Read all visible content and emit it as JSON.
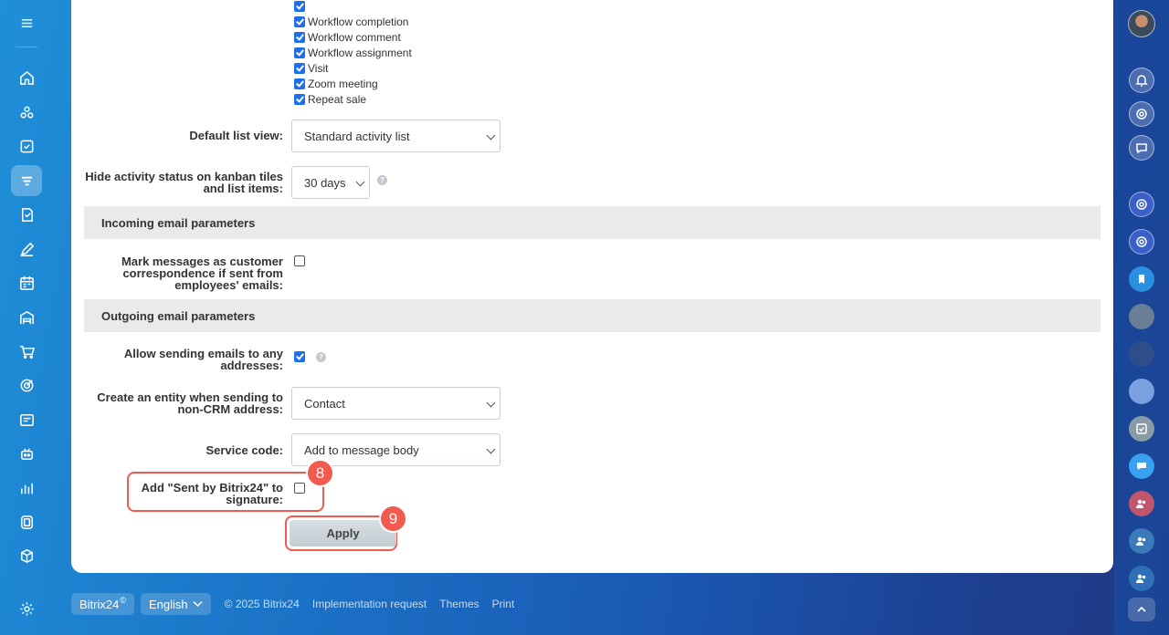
{
  "activity_types": {
    "items": [
      {
        "label": "",
        "checked": true
      },
      {
        "label": "Workflow completion",
        "checked": true
      },
      {
        "label": "Workflow comment",
        "checked": true
      },
      {
        "label": "Workflow assignment",
        "checked": true
      },
      {
        "label": "Visit",
        "checked": true
      },
      {
        "label": "Zoom meeting",
        "checked": true
      },
      {
        "label": "Repeat sale",
        "checked": true
      }
    ]
  },
  "settings": {
    "default_list_view": {
      "label": "Default list view:",
      "value": "Standard activity list"
    },
    "hide_status": {
      "label_line1": "Hide activity status on kanban tiles",
      "label_line2": "and list items:",
      "value": "30 days"
    },
    "incoming_header": "Incoming email parameters",
    "mark_messages": {
      "label_line1": "Mark messages as customer",
      "label_line2": "correspondence if sent from",
      "label_line3": "employees' emails:",
      "checked": false
    },
    "outgoing_header": "Outgoing email parameters",
    "allow_sending": {
      "label_line1": "Allow sending emails to any",
      "label_line2": "addresses:",
      "checked": true
    },
    "create_entity": {
      "label_line1": "Create an entity when sending to",
      "label_line2": "non-CRM address:",
      "value": "Contact"
    },
    "service_code": {
      "label": "Service code:",
      "value": "Add to message body"
    },
    "sent_by": {
      "label_line1": "Add \"Sent by Bitrix24\" to",
      "label_line2": "signature:",
      "checked": false
    },
    "apply_label": "Apply",
    "help_glyph": "?"
  },
  "badges": {
    "step8": "8",
    "step9": "9"
  },
  "footer": {
    "brand": "Bitrix24",
    "brand_mark": "©",
    "language": "English",
    "copyright": "© 2025 Bitrix24",
    "links": [
      "Implementation request",
      "Themes",
      "Print"
    ]
  },
  "left_sidebar": {
    "icons": [
      "menu-icon",
      "home-icon",
      "feed-icon",
      "tasks-icon",
      "crm-icon",
      "docs-icon",
      "sign-icon",
      "booking-icon",
      "store-icon",
      "shop-icon",
      "marketing-icon",
      "contact-center-icon",
      "automation-icon",
      "analytics-icon",
      "apps-icon",
      "box-icon",
      "settings-icon"
    ]
  },
  "right_sidebar": {
    "icons": [
      "user-avatar",
      "bell-icon",
      "copilot-icon",
      "chat-icon",
      "copilot-chat-1",
      "copilot-chat-2",
      "bookmark-icon",
      "chat-avatar-1",
      "chat-avatar-2",
      "chat-avatar-3",
      "task-chat-icon",
      "message-chat-icon",
      "group-chat-1",
      "group-chat-2",
      "group-chat-3",
      "scroll-up-icon"
    ]
  },
  "colors": {
    "accent": "#1f6feb",
    "highlight": "#f05a4f",
    "section_bg": "#e9eaec"
  }
}
